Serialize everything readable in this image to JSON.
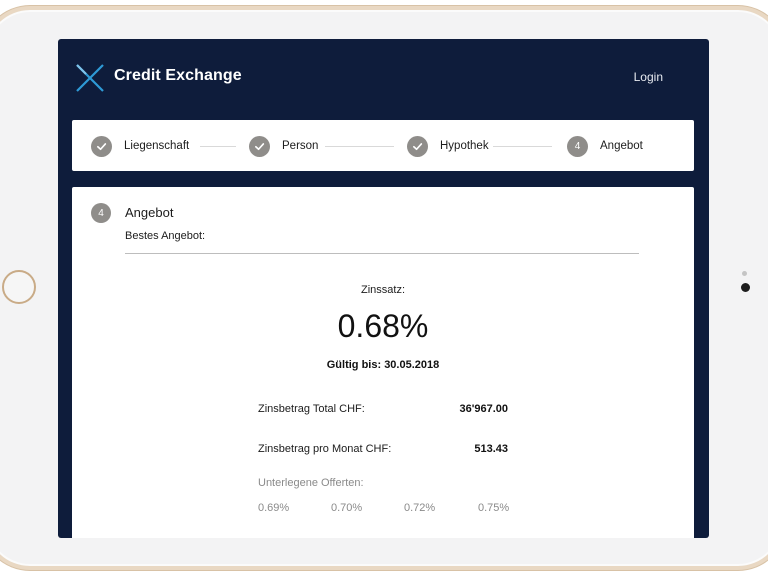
{
  "app": {
    "brand": "Credit Exchange",
    "login_label": "Login"
  },
  "colors": {
    "header_bg": "#0e1c3b",
    "logo_accent": "#2e9ad6",
    "step_circle": "#8f8d8a"
  },
  "stepper": {
    "steps": [
      {
        "label": "Liegenschaft",
        "status": "done",
        "icon": "check-icon"
      },
      {
        "label": "Person",
        "status": "done",
        "icon": "check-icon"
      },
      {
        "label": "Hypothek",
        "status": "done",
        "icon": "check-icon"
      },
      {
        "label": "Angebot",
        "status": "current",
        "number": "4"
      }
    ]
  },
  "offer": {
    "step_number": "4",
    "title": "Angebot",
    "subtitle": "Bestes Angebot:",
    "rate_label": "Zinssatz:",
    "rate_value": "0.68%",
    "valid_until": "Gültig bis:  30.05.2018",
    "interest_total_label": "Zinsbetrag Total CHF:",
    "interest_total_value": "36'967.00",
    "interest_monthly_label": "Zinsbetrag pro Monat CHF:",
    "interest_monthly_value": "513.43",
    "other_offers_label": "Unterlegene Offerten:",
    "other_offers": [
      "0.69%",
      "0.70%",
      "0.72%",
      "0.75%"
    ]
  }
}
